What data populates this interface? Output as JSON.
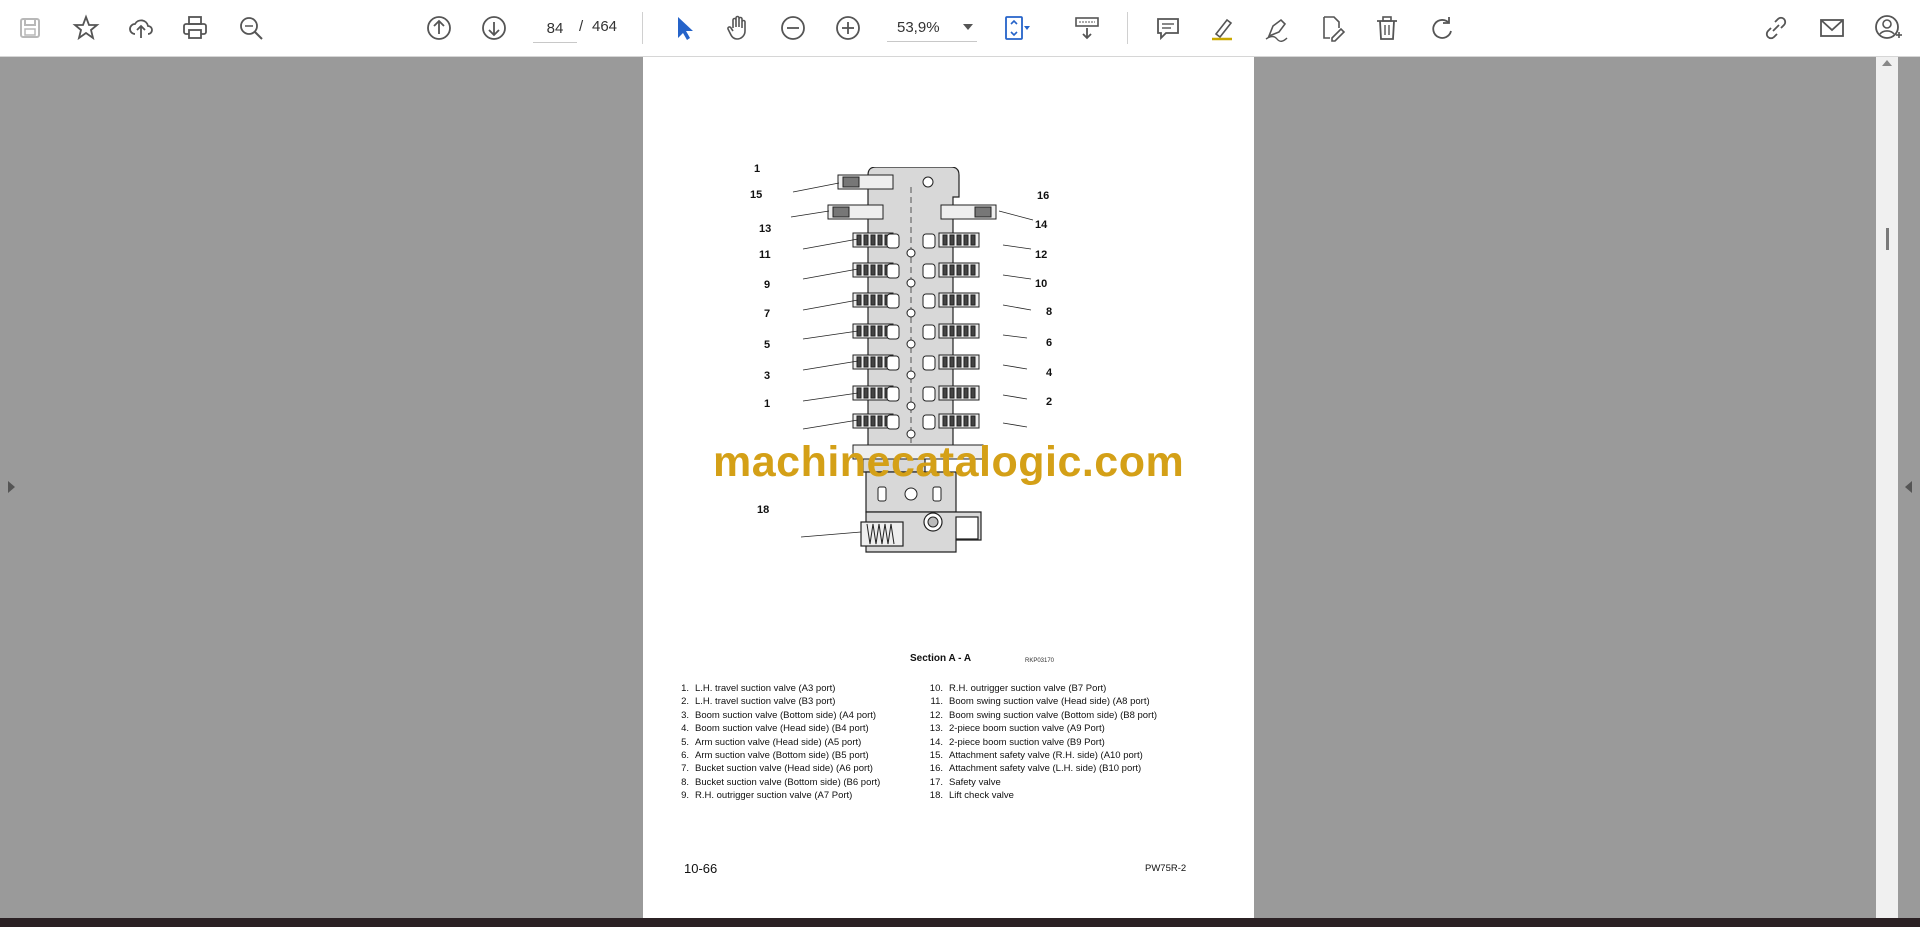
{
  "toolbar": {
    "page_current": "84",
    "page_separator": "/",
    "page_total": "464",
    "zoom": "53,9%",
    "icons": [
      "save-icon",
      "bookmark-star-icon",
      "upload-cloud-icon",
      "print-icon",
      "find-icon",
      "page-up-icon",
      "page-down-icon",
      "select-cursor-icon",
      "hand-icon",
      "zoom-out-icon",
      "zoom-in-icon",
      "fit-page-icon",
      "scroll-mode-icon",
      "comment-icon",
      "highlight-icon",
      "draw-icon",
      "edit-pdf-icon",
      "delete-icon",
      "rotate-icon",
      "share-link-icon",
      "email-icon",
      "account-icon"
    ]
  },
  "document": {
    "figure_caption": "Section A - A",
    "figure_code": "RKP03170",
    "callouts_left": [
      "1",
      "15",
      "13",
      "11",
      "9",
      "7",
      "5",
      "3",
      "1",
      "18"
    ],
    "callouts_right": [
      "16",
      "14",
      "12",
      "10",
      "8",
      "6",
      "4",
      "2"
    ],
    "legend_left": [
      {
        "num": "1.",
        "text": "L.H. travel suction valve (A3 port)"
      },
      {
        "num": "2.",
        "text": "L.H. travel suction valve (B3 port)"
      },
      {
        "num": "3.",
        "text": "Boom suction valve (Bottom side) (A4 port)"
      },
      {
        "num": "4.",
        "text": "Boom suction valve (Head side) (B4 port)"
      },
      {
        "num": "5.",
        "text": "Arm suction valve (Head side) (A5 port)"
      },
      {
        "num": "6.",
        "text": "Arm suction valve (Bottom side) (B5 port)"
      },
      {
        "num": "7.",
        "text": "Bucket suction valve (Head side) (A6 port)"
      },
      {
        "num": "8.",
        "text": "Bucket suction valve (Bottom side) (B6 port)"
      },
      {
        "num": "9.",
        "text": "R.H. outrigger suction valve (A7 Port)"
      }
    ],
    "legend_right": [
      {
        "num": "10.",
        "text": "R.H. outrigger suction valve (B7 Port)"
      },
      {
        "num": "11.",
        "text": "Boom swing suction valve (Head side) (A8 port)"
      },
      {
        "num": "12.",
        "text": "Boom swing suction valve (Bottom side) (B8 port)"
      },
      {
        "num": "13.",
        "text": "2-piece boom suction valve (A9 Port)"
      },
      {
        "num": "14.",
        "text": "2-piece boom suction valve (B9 Port)"
      },
      {
        "num": "15.",
        "text": "Attachment safety valve (R.H. side) (A10 port)"
      },
      {
        "num": "16.",
        "text": "Attachment safety valve (L.H. side) (B10 port)"
      },
      {
        "num": "17.",
        "text": "Safety valve"
      },
      {
        "num": "18.",
        "text": "Lift check valve"
      }
    ],
    "page_number": "10-66",
    "model": "PW75R-2",
    "watermark": "machinecatalogic.com"
  },
  "colors": {
    "accent": "#2563c9",
    "watermark": "#d4a017",
    "viewer_bg": "#9a9a9a"
  }
}
